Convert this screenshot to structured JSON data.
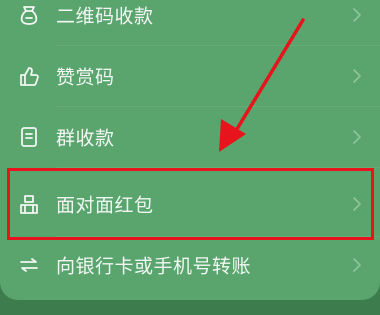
{
  "menu": {
    "items": [
      {
        "label": "二维码收款",
        "icon": "qr-pouch-icon"
      },
      {
        "label": "赞赏码",
        "icon": "thumbs-up-icon"
      },
      {
        "label": "群收款",
        "icon": "group-collect-icon"
      },
      {
        "label": "面对面红包",
        "icon": "red-packet-icon"
      },
      {
        "label": "向银行卡或手机号转账",
        "icon": "transfer-icon"
      }
    ]
  },
  "colors": {
    "panel": "#5aa46e",
    "backdrop": "#3c7c4d",
    "annotation": "#e8141b"
  }
}
